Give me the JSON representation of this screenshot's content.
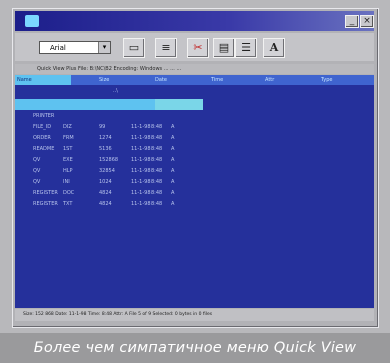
{
  "toolbar": {
    "font_value": "Arial",
    "dropdown_arrow": "▾",
    "buttons": [
      "▭",
      "≡",
      "✂",
      "▤",
      "☰",
      "A"
    ]
  },
  "path_bar": {
    "text": "Quick View Plus  File: B:\\NC\\B2  Encoding: Windows  ...  ...  ..."
  },
  "panel_headers": [
    "Name",
    "Size",
    "Date",
    "Time",
    "Attr",
    "Type"
  ],
  "dir_line": "..\\",
  "files": [
    {
      "name": "PRINTER",
      "ext": "",
      "size": "",
      "date": "",
      "time": "",
      "attr": ""
    },
    {
      "name": "FILE_ID",
      "ext": "DIZ",
      "size": "99",
      "date": "11-1-98",
      "time": "8:48",
      "attr": "A"
    },
    {
      "name": "ORDER",
      "ext": "FRM",
      "size": "1274",
      "date": "11-1-98",
      "time": "8:48",
      "attr": "A"
    },
    {
      "name": "README",
      "ext": "1ST",
      "size": "5136",
      "date": "11-1-98",
      "time": "8:48",
      "attr": "A"
    },
    {
      "name": "QV",
      "ext": "EXE",
      "size": "152868",
      "date": "11-1-98",
      "time": "8:48",
      "attr": "A"
    },
    {
      "name": "QV",
      "ext": "HLP",
      "size": "32854",
      "date": "11-1-98",
      "time": "8:48",
      "attr": "A"
    },
    {
      "name": "QV",
      "ext": "INI",
      "size": "1024",
      "date": "11-1-98",
      "time": "8:48",
      "attr": "A"
    },
    {
      "name": "REGISTER",
      "ext": "DOC",
      "size": "4824",
      "date": "11-1-98",
      "time": "8:48",
      "attr": "A"
    },
    {
      "name": "REGISTER",
      "ext": "TXT",
      "size": "4824",
      "date": "11-1-98",
      "time": "8:48",
      "attr": "A"
    }
  ],
  "status_bar": "Size: 152 868  Date: 11-1-98  Time: 8:48  Attr: A   File 5 of 9   Selected: 0 bytes in 0 files",
  "caption": "Более чем симпатичное меню Quick View"
}
